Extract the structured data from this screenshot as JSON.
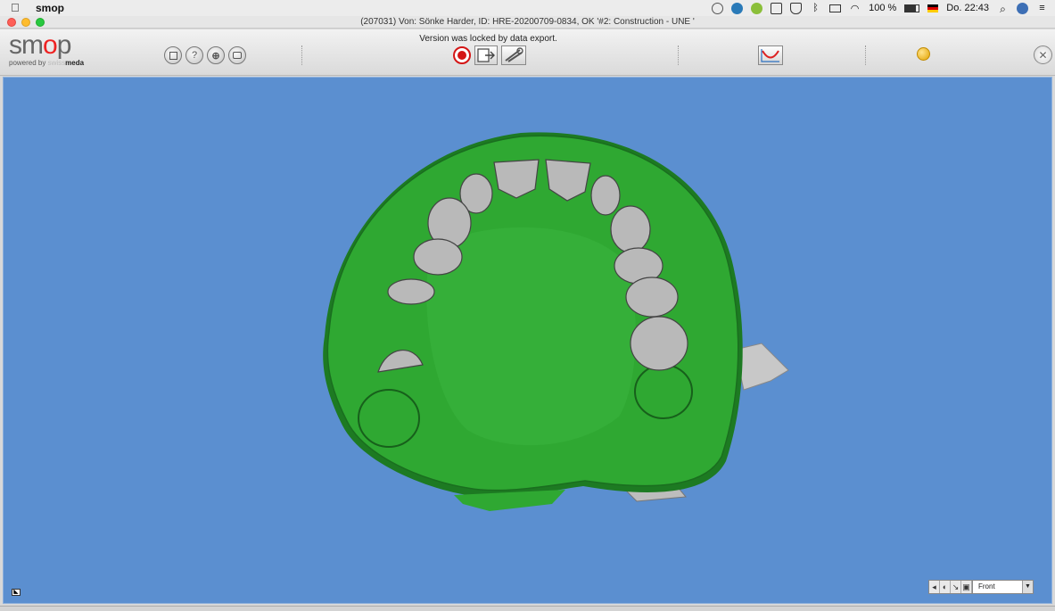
{
  "menubar": {
    "app_name": "smop",
    "battery": "100 %",
    "clock": "Do. 22:43"
  },
  "window": {
    "title": "(207031) Von: Sönke Harder, ID: HRE-20200709-0834, OK  '#2: Construction - UNE '"
  },
  "logo": {
    "word_start": "sm",
    "word_o": "o",
    "word_end": "p",
    "powered_by": "powered by ",
    "swiss": "swiss",
    "meda": "meda"
  },
  "toolbar": {
    "locked_message": "Version was locked by data export.",
    "icons": [
      "save-icon",
      "help-icon",
      "add-icon",
      "camera-icon",
      "lock-icon",
      "export-icon",
      "tools-icon",
      "curve-icon",
      "status-orb",
      "close-icon"
    ]
  },
  "viewport": {
    "background": "#5b8fd0",
    "model_color": "#2fa832",
    "view_select": "Front"
  }
}
